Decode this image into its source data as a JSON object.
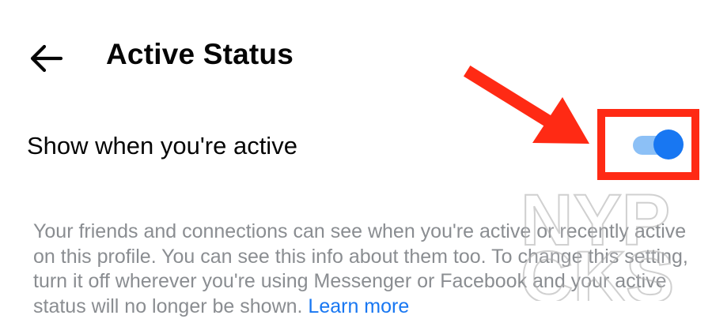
{
  "header": {
    "back_icon": "arrow-left-icon",
    "title": "Active Status"
  },
  "setting": {
    "label": "Show when you're active",
    "toggle_state": "on",
    "toggle_track_color": "#8cc0f6",
    "toggle_thumb_color": "#1877f2"
  },
  "description": {
    "text": "Your friends and connections can see when you're active or recently active on this profile. You can see this info about them too. To change this setting, turn it off wherever you're using Messenger or Facebook and your active status will no longer be shown.",
    "link_label": "Learn more",
    "link_color": "#1877f2"
  },
  "annotation": {
    "highlight_color": "#ff2a14",
    "arrow_icon": "red-arrow-icon"
  },
  "watermark": {
    "line1": "NYP",
    "line2": "CKS"
  }
}
